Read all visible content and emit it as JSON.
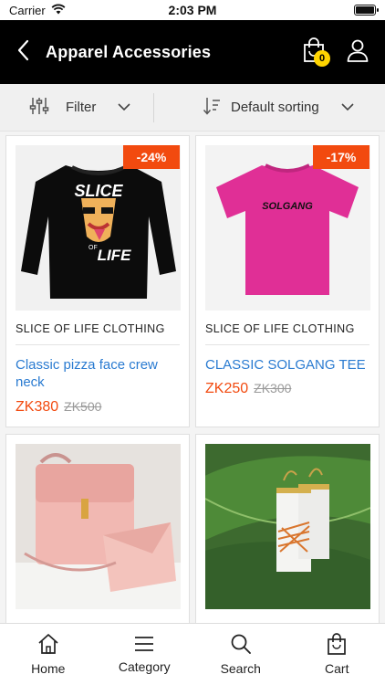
{
  "status": {
    "carrier": "Carrier",
    "time": "2:03 PM"
  },
  "header": {
    "title": "Apparel Accessories",
    "cart_count": "0"
  },
  "toolbar": {
    "filter_label": "Filter",
    "sort_label": "Default sorting"
  },
  "products": [
    {
      "discount": "-24%",
      "brand": "SLICE OF LIFE CLOTHING",
      "name": "Classic pizza face crew neck",
      "price": "ZK380",
      "old_price": "ZK500"
    },
    {
      "discount": "-17%",
      "brand": "SLICE OF LIFE CLOTHING",
      "name": "CLASSIC SOLGANG TEE",
      "price": "ZK250",
      "old_price": "ZK300"
    },
    {
      "image_text": ""
    },
    {
      "image_text": ""
    }
  ],
  "product_art": {
    "sweater_text_top": "SLICE",
    "sweater_text_mid": "OF",
    "sweater_text_bottom": "LIFE",
    "tee_text": "SOLGANG"
  },
  "nav": {
    "home": "Home",
    "category": "Category",
    "search": "Search",
    "cart": "Cart"
  },
  "colors": {
    "accent": "#f24a0f",
    "link": "#2a7bd1",
    "badge": "#ffd400",
    "header_bg": "#000000"
  }
}
